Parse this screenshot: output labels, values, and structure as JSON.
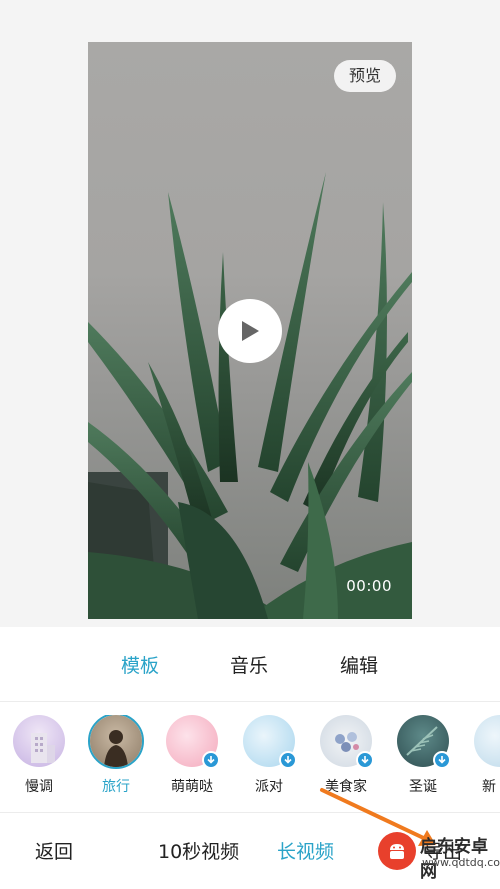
{
  "preview": {
    "preview_label": "预览",
    "timecode": "00:00"
  },
  "tabs": [
    {
      "label": "模板",
      "active": true
    },
    {
      "label": "音乐",
      "active": false
    },
    {
      "label": "编辑",
      "active": false
    }
  ],
  "templates": [
    {
      "label": "慢调",
      "selected": false,
      "downloadable": false
    },
    {
      "label": "旅行",
      "selected": true,
      "downloadable": false
    },
    {
      "label": "萌萌哒",
      "selected": false,
      "downloadable": true
    },
    {
      "label": "派对",
      "selected": false,
      "downloadable": true
    },
    {
      "label": "美食家",
      "selected": false,
      "downloadable": true
    },
    {
      "label": "圣诞",
      "selected": false,
      "downloadable": true
    },
    {
      "label": "新",
      "selected": false,
      "downloadable": false
    }
  ],
  "bottom_bar": {
    "back_label": "返回",
    "short_video_label": "10秒视频",
    "long_video_label": "长视频",
    "next_label": "导出"
  },
  "watermark": {
    "title": "启东安卓网",
    "url": "www.qdtdq.com"
  },
  "colors": {
    "accent": "#2aa3c8",
    "download_badge": "#2a98d6",
    "arrow": "#f07a1e"
  },
  "icons": [
    "play-icon",
    "download-icon",
    "arrow-annotation"
  ]
}
